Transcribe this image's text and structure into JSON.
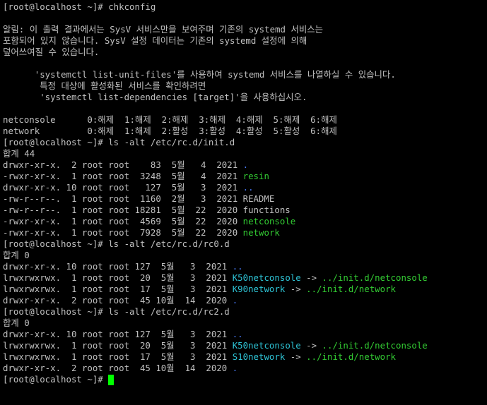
{
  "colors": {
    "background": "#000000",
    "text": "#c0c0c0",
    "executable": "#33cc33",
    "symlink": "#2ec4d6",
    "directory": "#4a7cff",
    "cursor": "#00ff00"
  },
  "lines": [
    {
      "segments": [
        {
          "t": "[root@localhost ~]# chkconfig"
        }
      ]
    },
    {
      "segments": [
        {
          "t": ""
        }
      ]
    },
    {
      "segments": [
        {
          "t": "알림: 이 출력 결과에서는 SysV 서비스만을 보여주며 기존의 systemd 서비스는"
        }
      ]
    },
    {
      "segments": [
        {
          "t": "포함되어 있지 않습니다. SysV 설정 데이터는 기존의 systemd 설정에 의해"
        }
      ]
    },
    {
      "segments": [
        {
          "t": "덮어쓰여질 수 있습니다."
        }
      ]
    },
    {
      "segments": [
        {
          "t": ""
        }
      ]
    },
    {
      "segments": [
        {
          "t": "      'systemctl list-unit-files'를 사용하여 systemd 서비스를 나열하실 수 있습니다."
        }
      ]
    },
    {
      "segments": [
        {
          "t": "       특정 대상에 활성화된 서비스를 확인하려면"
        }
      ]
    },
    {
      "segments": [
        {
          "t": "       'systemctl list-dependencies [target]'을 사용하십시오."
        }
      ]
    },
    {
      "segments": [
        {
          "t": ""
        }
      ]
    },
    {
      "segments": [
        {
          "t": "netconsole      0:해제  1:해제  2:해제  3:해제  4:해제  5:해제  6:해제"
        }
      ]
    },
    {
      "segments": [
        {
          "t": "network         0:해제  1:해제  2:활성  3:활성  4:활성  5:활성  6:해제"
        }
      ]
    },
    {
      "segments": [
        {
          "t": "[root@localhost ~]# ls -alt /etc/rc.d/init.d"
        }
      ]
    },
    {
      "segments": [
        {
          "t": "합계 44"
        }
      ]
    },
    {
      "segments": [
        {
          "t": "drwxr-xr-x.  2 root root    83  5월   4  2021 "
        },
        {
          "t": ".",
          "c": "directory"
        }
      ]
    },
    {
      "segments": [
        {
          "t": "-rwxr-xr-x.  1 root root  3248  5월   4  2021 "
        },
        {
          "t": "resin",
          "c": "executable"
        }
      ]
    },
    {
      "segments": [
        {
          "t": "drwxr-xr-x. 10 root root   127  5월   3  2021 "
        },
        {
          "t": "..",
          "c": "directory"
        }
      ]
    },
    {
      "segments": [
        {
          "t": "-rw-r--r--.  1 root root  1160  2월   3  2021 README"
        }
      ]
    },
    {
      "segments": [
        {
          "t": "-rw-r--r--.  1 root root 18281  5월  22  2020 functions"
        }
      ]
    },
    {
      "segments": [
        {
          "t": "-rwxr-xr-x.  1 root root  4569  5월  22  2020 "
        },
        {
          "t": "netconsole",
          "c": "executable"
        }
      ]
    },
    {
      "segments": [
        {
          "t": "-rwxr-xr-x.  1 root root  7928  5월  22  2020 "
        },
        {
          "t": "network",
          "c": "executable"
        }
      ]
    },
    {
      "segments": [
        {
          "t": "[root@localhost ~]# ls -alt /etc/rc.d/rc0.d"
        }
      ]
    },
    {
      "segments": [
        {
          "t": "합계 0"
        }
      ]
    },
    {
      "segments": [
        {
          "t": "drwxr-xr-x. 10 root root 127  5월   3  2021 "
        },
        {
          "t": "..",
          "c": "directory"
        }
      ]
    },
    {
      "segments": [
        {
          "t": "lrwxrwxrwx.  1 root root  20  5월   3  2021 "
        },
        {
          "t": "K50netconsole",
          "c": "symlink"
        },
        {
          "t": " -> "
        },
        {
          "t": "../init.d/netconsole",
          "c": "executable"
        }
      ]
    },
    {
      "segments": [
        {
          "t": "lrwxrwxrwx.  1 root root  17  5월   3  2021 "
        },
        {
          "t": "K90network",
          "c": "symlink"
        },
        {
          "t": " -> "
        },
        {
          "t": "../init.d/network",
          "c": "executable"
        }
      ]
    },
    {
      "segments": [
        {
          "t": "drwxr-xr-x.  2 root root  45 10월  14  2020 "
        },
        {
          "t": ".",
          "c": "directory"
        }
      ]
    },
    {
      "segments": [
        {
          "t": "[root@localhost ~]# ls -alt /etc/rc.d/rc2.d"
        }
      ]
    },
    {
      "segments": [
        {
          "t": "합계 0"
        }
      ]
    },
    {
      "segments": [
        {
          "t": "drwxr-xr-x. 10 root root 127  5월   3  2021 "
        },
        {
          "t": "..",
          "c": "directory"
        }
      ]
    },
    {
      "segments": [
        {
          "t": "lrwxrwxrwx.  1 root root  20  5월   3  2021 "
        },
        {
          "t": "K50netconsole",
          "c": "symlink"
        },
        {
          "t": " -> "
        },
        {
          "t": "../init.d/netconsole",
          "c": "executable"
        }
      ]
    },
    {
      "segments": [
        {
          "t": "lrwxrwxrwx.  1 root root  17  5월   3  2021 "
        },
        {
          "t": "S10network",
          "c": "symlink"
        },
        {
          "t": " -> "
        },
        {
          "t": "../init.d/network",
          "c": "executable"
        }
      ]
    },
    {
      "segments": [
        {
          "t": "drwxr-xr-x.  2 root root  45 10월  14  2020 "
        },
        {
          "t": ".",
          "c": "directory"
        }
      ]
    },
    {
      "segments": [
        {
          "t": "[root@localhost ~]# "
        }
      ],
      "cursor": true
    }
  ]
}
